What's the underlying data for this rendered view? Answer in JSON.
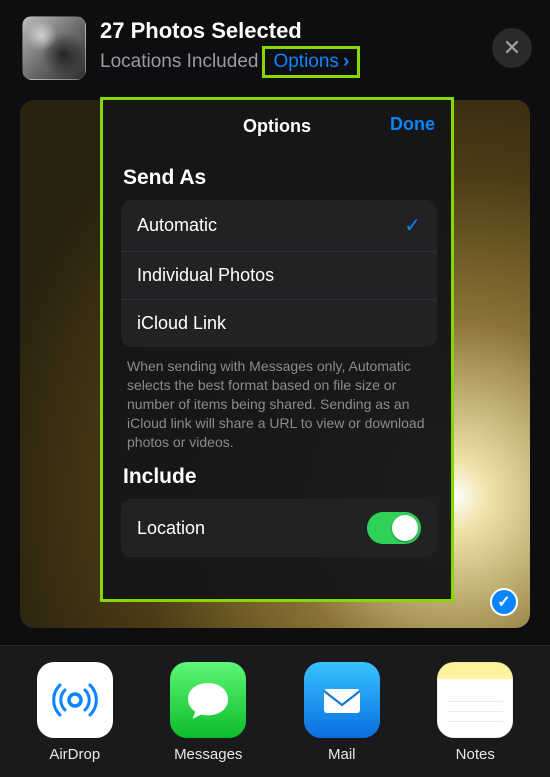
{
  "header": {
    "title": "27 Photos Selected",
    "subtitle": "Locations Included",
    "options_label": "Options",
    "close_glyph": "✕"
  },
  "options_panel": {
    "title": "Options",
    "done_label": "Done",
    "send_as_title": "Send As",
    "send_as": [
      {
        "label": "Automatic",
        "selected": true
      },
      {
        "label": "Individual Photos",
        "selected": false
      },
      {
        "label": "iCloud Link",
        "selected": false
      }
    ],
    "send_as_note": "When sending with Messages only, Automatic selects the best format based on file size or number of items being shared. Sending as an iCloud link will share a URL to view or download photos or videos.",
    "include_title": "Include",
    "include_location_label": "Location",
    "include_location_on": true
  },
  "preview": {
    "selected_glyph": "✓"
  },
  "share_row": [
    {
      "key": "airdrop",
      "label": "AirDrop"
    },
    {
      "key": "messages",
      "label": "Messages"
    },
    {
      "key": "mail",
      "label": "Mail"
    },
    {
      "key": "notes",
      "label": "Notes"
    }
  ],
  "chevron_glyph": "›",
  "check_glyph": "✓"
}
